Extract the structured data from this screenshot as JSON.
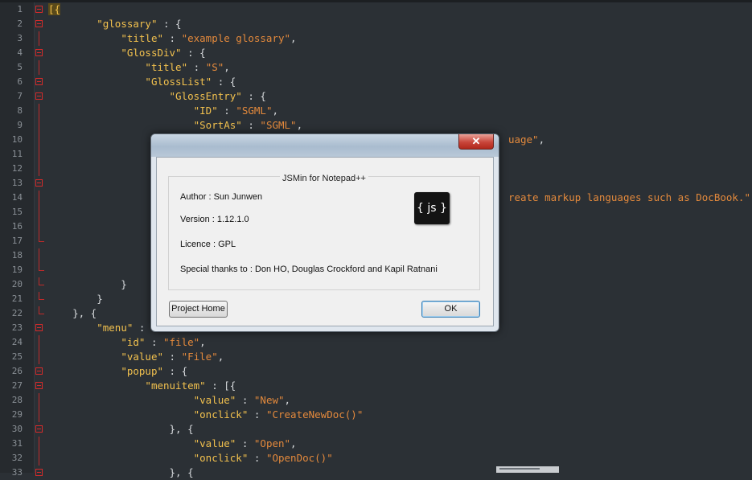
{
  "editor": {
    "lines": [
      {
        "n": "1",
        "fold": "open",
        "segs": [
          {
            "t": "[{",
            "c": "bracket-first"
          }
        ]
      },
      {
        "n": "2",
        "fold": "open",
        "segs": [
          {
            "t": "        ",
            "c": "pun"
          },
          {
            "t": "\"glossary\"",
            "c": "key"
          },
          {
            "t": " : {",
            "c": "pun"
          }
        ]
      },
      {
        "n": "3",
        "fold": "line",
        "segs": [
          {
            "t": "            ",
            "c": "pun"
          },
          {
            "t": "\"title\"",
            "c": "key"
          },
          {
            "t": " : ",
            "c": "pun"
          },
          {
            "t": "\"example glossary\"",
            "c": "str"
          },
          {
            "t": ",",
            "c": "pun"
          }
        ]
      },
      {
        "n": "4",
        "fold": "open",
        "segs": [
          {
            "t": "            ",
            "c": "pun"
          },
          {
            "t": "\"GlossDiv\"",
            "c": "key"
          },
          {
            "t": " : {",
            "c": "pun"
          }
        ]
      },
      {
        "n": "5",
        "fold": "line",
        "segs": [
          {
            "t": "                ",
            "c": "pun"
          },
          {
            "t": "\"title\"",
            "c": "key"
          },
          {
            "t": " : ",
            "c": "pun"
          },
          {
            "t": "\"S\"",
            "c": "str"
          },
          {
            "t": ",",
            "c": "pun"
          }
        ]
      },
      {
        "n": "6",
        "fold": "open",
        "segs": [
          {
            "t": "                ",
            "c": "pun"
          },
          {
            "t": "\"GlossList\"",
            "c": "key"
          },
          {
            "t": " : {",
            "c": "pun"
          }
        ]
      },
      {
        "n": "7",
        "fold": "open",
        "segs": [
          {
            "t": "                    ",
            "c": "pun"
          },
          {
            "t": "\"GlossEntry\"",
            "c": "key"
          },
          {
            "t": " : {",
            "c": "pun"
          }
        ]
      },
      {
        "n": "8",
        "fold": "line",
        "segs": [
          {
            "t": "                        ",
            "c": "pun"
          },
          {
            "t": "\"ID\"",
            "c": "key"
          },
          {
            "t": " : ",
            "c": "pun"
          },
          {
            "t": "\"SGML\"",
            "c": "str"
          },
          {
            "t": ",",
            "c": "pun"
          }
        ]
      },
      {
        "n": "9",
        "fold": "line",
        "segs": [
          {
            "t": "                        ",
            "c": "pun"
          },
          {
            "t": "\"SortAs\"",
            "c": "key"
          },
          {
            "t": " : ",
            "c": "pun"
          },
          {
            "t": "\"SGML\"",
            "c": "str"
          },
          {
            "t": ",",
            "c": "pun"
          }
        ]
      },
      {
        "n": "10",
        "fold": "line",
        "segs": [
          {
            "t": "                                                                            ",
            "c": "pun"
          },
          {
            "t": "uage\"",
            "c": "str"
          },
          {
            "t": ",",
            "c": "pun"
          }
        ]
      },
      {
        "n": "11",
        "fold": "line",
        "segs": []
      },
      {
        "n": "12",
        "fold": "line",
        "segs": []
      },
      {
        "n": "13",
        "fold": "open",
        "segs": []
      },
      {
        "n": "14",
        "fold": "line",
        "segs": [
          {
            "t": "                                                                            ",
            "c": "pun"
          },
          {
            "t": "reate markup languages such as DocBook.\"",
            "c": "str"
          },
          {
            "t": ",",
            "c": "pun"
          }
        ]
      },
      {
        "n": "15",
        "fold": "line",
        "segs": []
      },
      {
        "n": "16",
        "fold": "line",
        "segs": []
      },
      {
        "n": "17",
        "fold": "end",
        "segs": []
      },
      {
        "n": "18",
        "fold": "line",
        "segs": []
      },
      {
        "n": "19",
        "fold": "end",
        "segs": []
      },
      {
        "n": "20",
        "fold": "end",
        "segs": [
          {
            "t": "            }",
            "c": "pun"
          }
        ]
      },
      {
        "n": "21",
        "fold": "end",
        "segs": [
          {
            "t": "        }",
            "c": "pun"
          }
        ]
      },
      {
        "n": "22",
        "fold": "end",
        "segs": [
          {
            "t": "    }, {",
            "c": "pun"
          }
        ]
      },
      {
        "n": "23",
        "fold": "open",
        "segs": [
          {
            "t": "        ",
            "c": "pun"
          },
          {
            "t": "\"menu\"",
            "c": "key"
          },
          {
            "t": " :",
            "c": "pun"
          }
        ]
      },
      {
        "n": "24",
        "fold": "line",
        "segs": [
          {
            "t": "            ",
            "c": "pun"
          },
          {
            "t": "\"id\"",
            "c": "key"
          },
          {
            "t": " : ",
            "c": "pun"
          },
          {
            "t": "\"file\"",
            "c": "str"
          },
          {
            "t": ",",
            "c": "pun"
          }
        ]
      },
      {
        "n": "25",
        "fold": "line",
        "segs": [
          {
            "t": "            ",
            "c": "pun"
          },
          {
            "t": "\"value\"",
            "c": "key"
          },
          {
            "t": " : ",
            "c": "pun"
          },
          {
            "t": "\"File\"",
            "c": "str"
          },
          {
            "t": ",",
            "c": "pun"
          }
        ]
      },
      {
        "n": "26",
        "fold": "open",
        "segs": [
          {
            "t": "            ",
            "c": "pun"
          },
          {
            "t": "\"popup\"",
            "c": "key"
          },
          {
            "t": " : {",
            "c": "pun"
          }
        ]
      },
      {
        "n": "27",
        "fold": "open",
        "segs": [
          {
            "t": "                ",
            "c": "pun"
          },
          {
            "t": "\"menuitem\"",
            "c": "key"
          },
          {
            "t": " : [{",
            "c": "pun"
          }
        ]
      },
      {
        "n": "28",
        "fold": "line",
        "segs": [
          {
            "t": "                        ",
            "c": "pun"
          },
          {
            "t": "\"value\"",
            "c": "key"
          },
          {
            "t": " : ",
            "c": "pun"
          },
          {
            "t": "\"New\"",
            "c": "str"
          },
          {
            "t": ",",
            "c": "pun"
          }
        ]
      },
      {
        "n": "29",
        "fold": "line",
        "segs": [
          {
            "t": "                        ",
            "c": "pun"
          },
          {
            "t": "\"onclick\"",
            "c": "key"
          },
          {
            "t": " : ",
            "c": "pun"
          },
          {
            "t": "\"CreateNewDoc()\"",
            "c": "str"
          }
        ]
      },
      {
        "n": "30",
        "fold": "open",
        "segs": [
          {
            "t": "                    }, {",
            "c": "pun"
          }
        ]
      },
      {
        "n": "31",
        "fold": "line",
        "segs": [
          {
            "t": "                        ",
            "c": "pun"
          },
          {
            "t": "\"value\"",
            "c": "key"
          },
          {
            "t": " : ",
            "c": "pun"
          },
          {
            "t": "\"Open\"",
            "c": "str"
          },
          {
            "t": ",",
            "c": "pun"
          }
        ]
      },
      {
        "n": "32",
        "fold": "line",
        "segs": [
          {
            "t": "                        ",
            "c": "pun"
          },
          {
            "t": "\"onclick\"",
            "c": "key"
          },
          {
            "t": " : ",
            "c": "pun"
          },
          {
            "t": "\"OpenDoc()\"",
            "c": "str"
          }
        ]
      },
      {
        "n": "33",
        "fold": "open",
        "segs": [
          {
            "t": "                    }, {",
            "c": "pun"
          }
        ]
      }
    ]
  },
  "dialog": {
    "close_symbol": "✕",
    "group_title": "JSMin for Notepad++",
    "author": "Author : Sun Junwen",
    "version": "Version : 1.12.1.0",
    "licence": "Licence : GPL",
    "thanks": "Special thanks to : Don HO, Douglas Crockford and Kapil Ratnani",
    "logo_text": "{ js }",
    "project_home_label": "Project Home",
    "ok_label": "OK"
  },
  "icons": {
    "close": "close-icon",
    "fold": "fold-minus-icon",
    "logo": "js-logo-icon"
  },
  "colors": {
    "editor_bg": "#2b3035",
    "key": "#f2c14e",
    "string": "#e3893c",
    "fold_marker": "#d42b2b"
  }
}
